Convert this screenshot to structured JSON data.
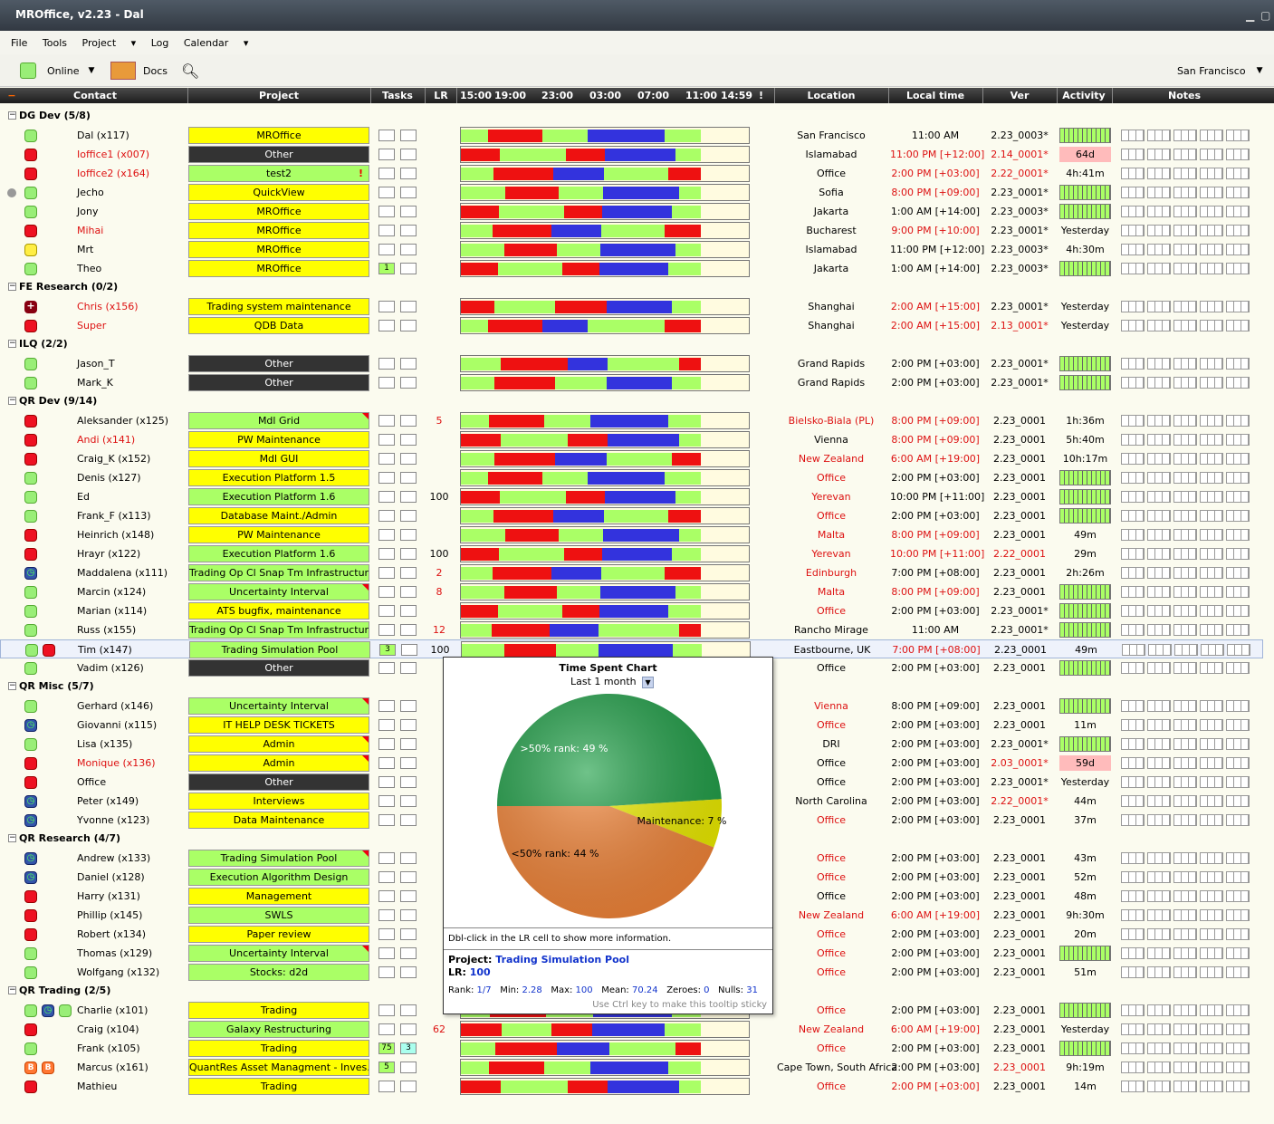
{
  "window": {
    "title": "MROffice, v2.23 - Dal"
  },
  "menu": [
    "File",
    "Tools",
    "Project",
    "Log",
    "Calendar"
  ],
  "toolbar": {
    "status_label": "Online",
    "docs_label": "Docs",
    "location_select": "San Francisco"
  },
  "columns": {
    "contact": "Contact",
    "project": "Project",
    "tasks": "Tasks",
    "lr": "LR",
    "times": [
      "15:00",
      "19:00",
      "23:00",
      "03:00",
      "07:00",
      "11:00",
      "14:59"
    ],
    "excl": "!",
    "location": "Location",
    "local_time": "Local time",
    "ver": "Ver",
    "activity": "Activity",
    "notes": "Notes"
  },
  "groups": [
    {
      "title": "DG Dev (5/8)",
      "rows": [
        {
          "status": "green",
          "name": "Dal (x117)",
          "project": "MROffice",
          "pcolor": "yellow",
          "location": "San Francisco",
          "time": "11:00 AM",
          "ver": "2.23_0003*",
          "activity": "bar"
        },
        {
          "status": "red",
          "name": "Ioffice1 (x007)",
          "nred": true,
          "project": "Other",
          "pcolor": "dark",
          "location": "Islamabad",
          "time": "11:00 PM [+12:00]",
          "tred": true,
          "ver": "2.14_0001*",
          "vred": true,
          "activity": "64d",
          "apink": true
        },
        {
          "status": "red",
          "name": "Ioffice2 (x164)",
          "nred": true,
          "project": "test2",
          "pcolor": "green",
          "excl": true,
          "location": "Office",
          "time": "2:00 PM [+03:00]",
          "tred": true,
          "ver": "2.22_0001*",
          "vred": true,
          "activity": "4h:41m"
        },
        {
          "status": "green",
          "pre": "grey",
          "name": "Jecho",
          "project": "QuickView",
          "pcolor": "yellow",
          "location": "Sofia",
          "time": "8:00 PM [+09:00]",
          "tred": true,
          "ver": "2.23_0001*",
          "activity": "bar"
        },
        {
          "status": "green",
          "name": "Jony",
          "project": "MROffice",
          "pcolor": "yellow",
          "location": "Jakarta",
          "time": "1:00 AM [+14:00]",
          "ver": "2.23_0003*",
          "activity": "bar"
        },
        {
          "status": "red",
          "name": "Mihai",
          "nred": true,
          "project": "MROffice",
          "pcolor": "yellow",
          "location": "Bucharest",
          "time": "9:00 PM [+10:00]",
          "tred": true,
          "ver": "2.23_0001*",
          "activity": "Yesterday"
        },
        {
          "status": "yellow",
          "name": "Mrt",
          "project": "MROffice",
          "pcolor": "yellow",
          "location": "Islamabad",
          "time": "11:00 PM [+12:00]",
          "ver": "2.23_0003*",
          "activity": "4h:30m"
        },
        {
          "status": "green",
          "name": "Theo",
          "project": "MROffice",
          "pcolor": "yellow",
          "task1": "1",
          "location": "Jakarta",
          "time": "1:00 AM [+14:00]",
          "ver": "2.23_0003*",
          "activity": "bar"
        }
      ]
    },
    {
      "title": "FE Research (0/2)",
      "rows": [
        {
          "status": "darkred",
          "name": "Chris (x156)",
          "nred": true,
          "project": "Trading system maintenance",
          "pcolor": "yellow",
          "location": "Shanghai",
          "time": "2:00 AM [+15:00]",
          "tred": true,
          "ver": "2.23_0001*",
          "activity": "Yesterday"
        },
        {
          "status": "red",
          "name": "Super",
          "nred": true,
          "project": "QDB Data",
          "pcolor": "yellow",
          "location": "Shanghai",
          "time": "2:00 AM [+15:00]",
          "tred": true,
          "ver": "2.13_0001*",
          "vred": true,
          "activity": "Yesterday"
        }
      ]
    },
    {
      "title": "ILQ (2/2)",
      "rows": [
        {
          "status": "green",
          "name": "Jason_T",
          "project": "Other",
          "pcolor": "dark",
          "location": "Grand Rapids",
          "time": "2:00 PM [+03:00]",
          "ver": "2.23_0001*",
          "activity": "bar"
        },
        {
          "status": "green",
          "name": "Mark_K",
          "project": "Other",
          "pcolor": "dark",
          "location": "Grand Rapids",
          "time": "2:00 PM [+03:00]",
          "ver": "2.23_0001*",
          "activity": "bar"
        }
      ]
    },
    {
      "title": "QR Dev (9/14)",
      "rows": [
        {
          "status": "red",
          "name": "Aleksander (x125)",
          "project": "Mdl Grid",
          "pcolor": "green",
          "flag": true,
          "lr": "5",
          "lrred": true,
          "location": "Bielsko-Biala (PL)",
          "lred": true,
          "time": "8:00 PM [+09:00]",
          "tred": true,
          "ver": "2.23_0001",
          "activity": "1h:36m"
        },
        {
          "status": "red",
          "name": "Andi (x141)",
          "nred": true,
          "project": "PW Maintenance",
          "pcolor": "yellow",
          "location": "Vienna",
          "time": "8:00 PM [+09:00]",
          "tred": true,
          "ver": "2.23_0001",
          "activity": "5h:40m"
        },
        {
          "status": "red",
          "name": "Craig_K (x152)",
          "project": "Mdl GUI",
          "pcolor": "yellow",
          "location": "New Zealand",
          "lred": true,
          "time": "6:00 AM [+19:00]",
          "tred": true,
          "ver": "2.23_0001",
          "activity": "10h:17m"
        },
        {
          "status": "green",
          "name": "Denis (x127)",
          "project": "Execution Platform 1.5",
          "pcolor": "yellow",
          "location": "Office",
          "lred": true,
          "time": "2:00 PM [+03:00]",
          "ver": "2.23_0001",
          "activity": "bar"
        },
        {
          "status": "green",
          "name": "Ed",
          "project": "Execution Platform 1.6",
          "pcolor": "green",
          "lr": "100",
          "location": "Yerevan",
          "lred": true,
          "time": "10:00 PM [+11:00]",
          "ver": "2.23_0001",
          "activity": "bar"
        },
        {
          "status": "green",
          "name": "Frank_F (x113)",
          "project": "Database Maint./Admin",
          "pcolor": "yellow",
          "location": "Office",
          "lred": true,
          "time": "2:00 PM [+03:00]",
          "ver": "2.23_0001",
          "activity": "bar"
        },
        {
          "status": "red",
          "name": "Heinrich (x148)",
          "project": "PW Maintenance",
          "pcolor": "yellow",
          "location": "Malta",
          "lred": true,
          "time": "8:00 PM [+09:00]",
          "tred": true,
          "ver": "2.23_0001",
          "activity": "49m"
        },
        {
          "status": "red",
          "name": "Hrayr (x122)",
          "project": "Execution Platform 1.6",
          "pcolor": "green",
          "lr": "100",
          "location": "Yerevan",
          "lred": true,
          "time": "10:00 PM [+11:00]",
          "tred": true,
          "ver": "2.22_0001",
          "vred": true,
          "activity": "29m"
        },
        {
          "status": "blue",
          "name": "Maddalena (x111)",
          "project": "Trading Op Cl Snap Tm Infrastructure",
          "pcolor": "green",
          "lr": "2",
          "lrred": true,
          "location": "Edinburgh",
          "lred": true,
          "time": "7:00 PM [+08:00]",
          "ver": "2.23_0001",
          "activity": "2h:26m"
        },
        {
          "status": "green",
          "name": "Marcin (x124)",
          "project": "Uncertainty Interval",
          "pcolor": "green",
          "flag": true,
          "lr": "8",
          "lrred": true,
          "location": "Malta",
          "lred": true,
          "time": "8:00 PM [+09:00]",
          "tred": true,
          "ver": "2.23_0001",
          "activity": "bar"
        },
        {
          "status": "green",
          "name": "Marian (x114)",
          "project": "ATS bugfix, maintenance",
          "pcolor": "yellow",
          "location": "Office",
          "lred": true,
          "time": "2:00 PM [+03:00]",
          "ver": "2.23_0001*",
          "activity": "bar"
        },
        {
          "status": "green",
          "name": "Russ (x155)",
          "project": "Trading Op Cl Snap Tm Infrastructure",
          "pcolor": "green",
          "lr": "12",
          "lrred": true,
          "location": "Rancho Mirage",
          "time": "11:00 AM",
          "ver": "2.23_0001*",
          "activity": "bar"
        },
        {
          "status": "green",
          "pre2": "red",
          "name": "Tim (x147)",
          "project": "Trading Simulation Pool",
          "pcolor": "green",
          "task1": "3",
          "lr": "100",
          "location": "Eastbourne, UK",
          "time": "7:00 PM [+08:00]",
          "tred": true,
          "ver": "2.23_0001",
          "activity": "49m",
          "sel": true
        },
        {
          "status": "green",
          "name": "Vadim (x126)",
          "project": "Other",
          "pcolor": "dark",
          "location": "Office",
          "time": "2:00 PM [+03:00]",
          "ver": "2.23_0001",
          "activity": "bar"
        }
      ]
    },
    {
      "title": "QR Misc (5/7)",
      "rows": [
        {
          "status": "green",
          "name": "Gerhard (x146)",
          "project": "Uncertainty Interval",
          "pcolor": "green",
          "flag": true,
          "location": "Vienna",
          "lred": true,
          "time": "8:00 PM [+09:00]",
          "ver": "2.23_0001",
          "activity": "bar"
        },
        {
          "status": "blue",
          "name": "Giovanni (x115)",
          "project": "IT HELP DESK TICKETS",
          "pcolor": "yellow",
          "location": "Office",
          "lred": true,
          "time": "2:00 PM [+03:00]",
          "ver": "2.23_0001",
          "activity": "11m"
        },
        {
          "status": "green",
          "name": "Lisa (x135)",
          "project": "Admin",
          "pcolor": "yellow",
          "flag": true,
          "location": "DRI",
          "time": "2:00 PM [+03:00]",
          "ver": "2.23_0001*",
          "activity": "bar"
        },
        {
          "status": "red",
          "name": "Monique (x136)",
          "nred": true,
          "project": "Admin",
          "pcolor": "yellow",
          "flag": true,
          "location": "Office",
          "time": "2:00 PM [+03:00]",
          "ver": "2.03_0001*",
          "vred": true,
          "activity": "59d",
          "apink": true
        },
        {
          "status": "red",
          "name": "Office",
          "project": "Other",
          "pcolor": "dark",
          "location": "Office",
          "time": "2:00 PM [+03:00]",
          "ver": "2.23_0001*",
          "activity": "Yesterday"
        },
        {
          "status": "blue",
          "name": "Peter (x149)",
          "project": "Interviews",
          "pcolor": "yellow",
          "location": "North Carolina",
          "time": "2:00 PM [+03:00]",
          "ver": "2.22_0001*",
          "vred": true,
          "activity": "44m"
        },
        {
          "status": "blue",
          "name": "Yvonne (x123)",
          "project": "Data Maintenance",
          "pcolor": "yellow",
          "location": "Office",
          "lred": true,
          "time": "2:00 PM [+03:00]",
          "ver": "2.23_0001",
          "activity": "37m"
        }
      ]
    },
    {
      "title": "QR Research (4/7)",
      "rows": [
        {
          "status": "blue",
          "name": "Andrew (x133)",
          "project": "Trading Simulation Pool",
          "pcolor": "green",
          "flag": true,
          "location": "Office",
          "lred": true,
          "time": "2:00 PM [+03:00]",
          "ver": "2.23_0001",
          "activity": "43m"
        },
        {
          "status": "blue",
          "name": "Daniel (x128)",
          "project": "Execution Algorithm Design",
          "pcolor": "green",
          "location": "Office",
          "lred": true,
          "time": "2:00 PM [+03:00]",
          "ver": "2.23_0001",
          "activity": "52m"
        },
        {
          "status": "red",
          "name": "Harry (x131)",
          "project": "Management",
          "pcolor": "yellow",
          "location": "Office",
          "time": "2:00 PM [+03:00]",
          "ver": "2.23_0001",
          "activity": "48m"
        },
        {
          "status": "red",
          "name": "Phillip (x145)",
          "project": "SWLS",
          "pcolor": "green",
          "location": "New Zealand",
          "lred": true,
          "time": "6:00 AM [+19:00]",
          "tred": true,
          "ver": "2.23_0001",
          "activity": "9h:30m"
        },
        {
          "status": "red",
          "name": "Robert (x134)",
          "project": "Paper review",
          "pcolor": "yellow",
          "location": "Office",
          "lred": true,
          "time": "2:00 PM [+03:00]",
          "ver": "2.23_0001",
          "activity": "20m"
        },
        {
          "status": "green",
          "name": "Thomas (x129)",
          "project": "Uncertainty Interval",
          "pcolor": "green",
          "flag": true,
          "location": "Office",
          "lred": true,
          "time": "2:00 PM [+03:00]",
          "ver": "2.23_0001",
          "activity": "bar"
        },
        {
          "status": "green",
          "name": "Wolfgang (x132)",
          "project": "Stocks: d2d",
          "pcolor": "green",
          "location": "Office",
          "lred": true,
          "time": "2:00 PM [+03:00]",
          "ver": "2.23_0001",
          "activity": "51m"
        }
      ]
    },
    {
      "title": "QR Trading (2/5)",
      "rows": [
        {
          "status": "green",
          "pre2": "blue",
          "pre3": "green",
          "name": "Charlie (x101)",
          "project": "Trading",
          "pcolor": "yellow",
          "location": "Office",
          "lred": true,
          "time": "2:00 PM [+03:00]",
          "ver": "2.23_0001",
          "activity": "bar"
        },
        {
          "status": "red",
          "name": "Craig (x104)",
          "project": "Galaxy Restructuring",
          "pcolor": "green",
          "lr": "62",
          "lrred": true,
          "location": "New Zealand",
          "lred": true,
          "time": "6:00 AM [+19:00]",
          "tred": true,
          "ver": "2.23_0001",
          "activity": "Yesterday"
        },
        {
          "status": "green",
          "name": "Frank (x105)",
          "project": "Trading",
          "pcolor": "yellow",
          "task1": "75",
          "task2": "3",
          "location": "Office",
          "lred": true,
          "time": "2:00 PM [+03:00]",
          "ver": "2.23_0001",
          "activity": "bar"
        },
        {
          "status": "orange",
          "pre2": "orange",
          "name": "Marcus (x161)",
          "project": "QuantRes Asset Managment - Inves...",
          "pcolor": "yellow",
          "task1": "5",
          "location": "Cape Town, South Africa",
          "time": "2:00 PM [+03:00]",
          "ver": "2.23_0001",
          "vred": true,
          "activity": "9h:19m"
        },
        {
          "status": "red",
          "name": "Mathieu",
          "project": "Trading",
          "pcolor": "yellow",
          "location": "Office",
          "lred": true,
          "time": "2:00 PM [+03:00]",
          "tred": true,
          "ver": "2.23_0001",
          "activity": "14m"
        }
      ]
    }
  ],
  "tooltip": {
    "title": "Time Spent Chart",
    "period": "Last 1 month",
    "hint": "Dbl-click in the LR cell to show more information.",
    "project_label": "Project:",
    "project_value": "Trading Simulation Pool",
    "lr_label": "LR:",
    "lr_value": "100",
    "rank_label": "Rank:",
    "rank_value": "1/7",
    "min_label": "Min:",
    "min_value": "2.28",
    "max_label": "Max:",
    "max_value": "100",
    "mean_label": "Mean:",
    "mean_value": "70.24",
    "zeroes_label": "Zeroes:",
    "zeroes_value": "0",
    "nulls_label": "Nulls:",
    "nulls_value": "31",
    "sticky_hint": "Use Ctrl key to make this tooltip sticky"
  },
  "chart_data": {
    "type": "pie",
    "title": "Time Spent Chart",
    "slices": [
      {
        "label": ">50% rank: 49 %",
        "value": 49,
        "color": "#22a24a"
      },
      {
        "label": "Maintenance: 7 %",
        "value": 7,
        "color": "#f2f200"
      },
      {
        "label": "<50% rank: 44 %",
        "value": 44,
        "color": "#f7893c"
      }
    ]
  }
}
